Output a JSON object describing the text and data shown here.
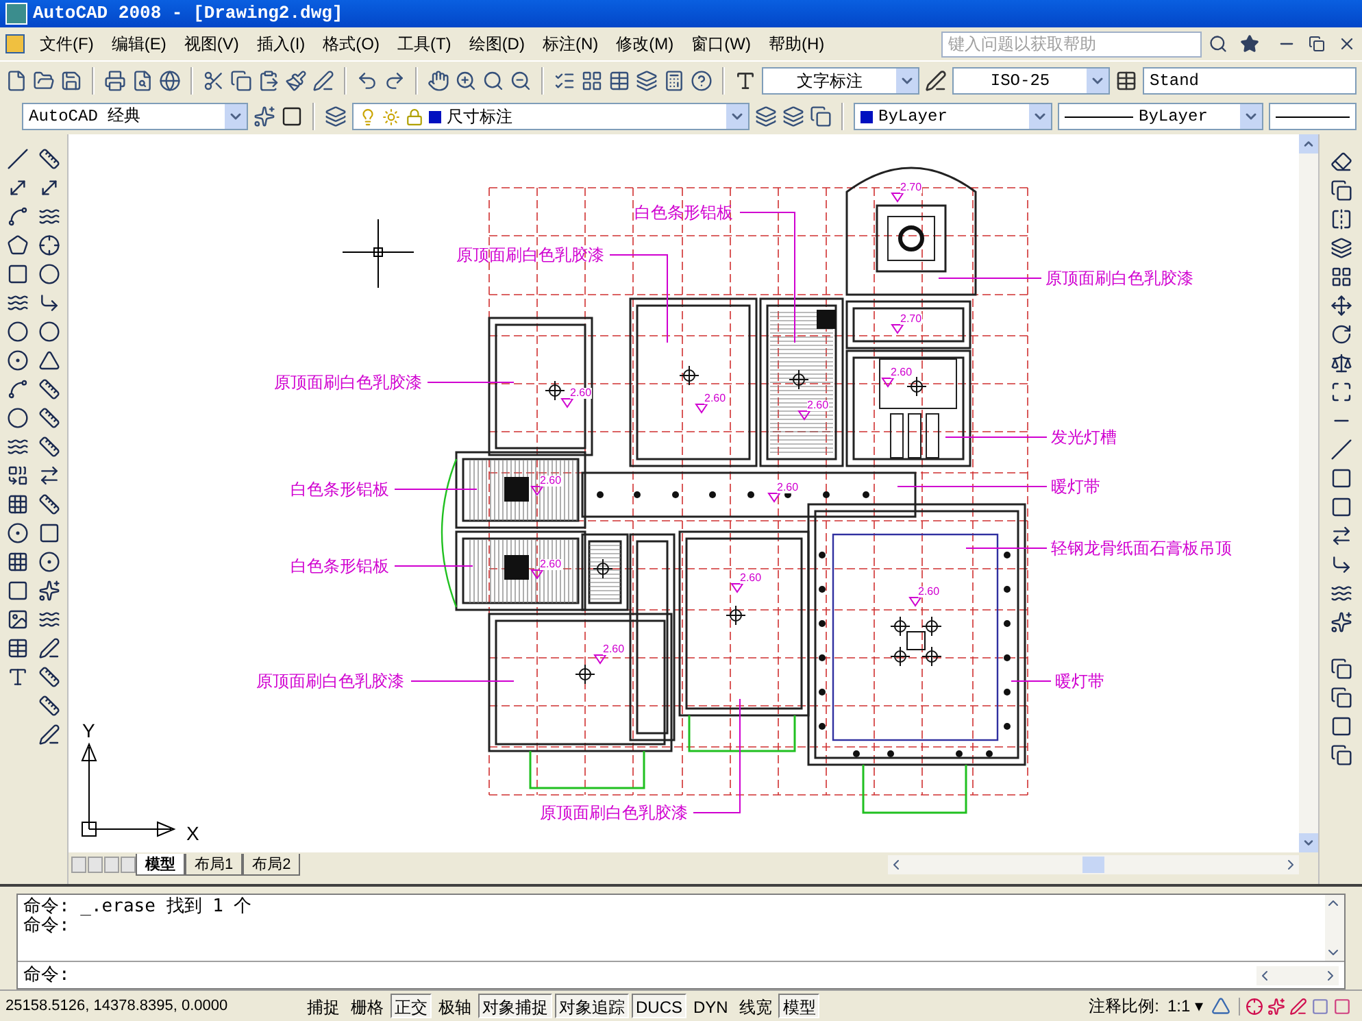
{
  "window": {
    "title": "AutoCAD 2008 - [Drawing2.dwg]"
  },
  "menu": [
    "文件(F)",
    "编辑(E)",
    "视图(V)",
    "插入(I)",
    "格式(O)",
    "工具(T)",
    "绘图(D)",
    "标注(N)",
    "修改(M)",
    "窗口(W)",
    "帮助(H)"
  ],
  "help_search": {
    "placeholder": "键入问题以获取帮助"
  },
  "styles_toolbar": {
    "text_style": "文字标注",
    "dim_style": "ISO-25",
    "table_style": "Stand"
  },
  "layers_toolbar": {
    "workspace": "AutoCAD 经典",
    "layer": "尺寸标注",
    "color_setting": "ByLayer",
    "linetype": "ByLayer"
  },
  "drawing": {
    "annotations": [
      {
        "text": "白色条形铝板"
      },
      {
        "text": "原顶面刷白色乳胶漆"
      },
      {
        "text": "原顶面刷白色乳胶漆"
      },
      {
        "text": "原顶面刷白色乳胶漆"
      },
      {
        "text": "发光灯槽"
      },
      {
        "text": "白色条形铝板"
      },
      {
        "text": "暖灯带"
      },
      {
        "text": "白色条形铝板"
      },
      {
        "text": "轻钢龙骨纸面石膏板吊顶"
      },
      {
        "text": "原顶面刷白色乳胶漆"
      },
      {
        "text": "暖灯带"
      },
      {
        "text": "原顶面刷白色乳胶漆"
      }
    ],
    "elevations": [
      "2.70",
      "2.70",
      "2.60",
      "2.60",
      "2.60",
      "2.60",
      "2.60",
      "2.60",
      "2.60",
      "2.60",
      "2.60",
      "2.60"
    ]
  },
  "ucs": {
    "y": "Y",
    "x": "X"
  },
  "layout_tabs": [
    {
      "label": "模型",
      "selected": true
    },
    {
      "label": "布局1",
      "selected": false
    },
    {
      "label": "布局2",
      "selected": false
    }
  ],
  "command_history": [
    "命令: _.erase 找到 1 个",
    "命令:"
  ],
  "command_prompt": "命令:",
  "status_bar": {
    "coordinates": "25158.5126, 14378.8395, 0.0000",
    "toggles": [
      {
        "label": "捕捉",
        "on": false
      },
      {
        "label": "栅格",
        "on": false
      },
      {
        "label": "正交",
        "on": true
      },
      {
        "label": "极轴",
        "on": false
      },
      {
        "label": "对象捕捉",
        "on": true
      },
      {
        "label": "对象追踪",
        "on": true
      },
      {
        "label": "DUCS",
        "on": true
      },
      {
        "label": "DYN",
        "on": false
      },
      {
        "label": "线宽",
        "on": false
      },
      {
        "label": "模型",
        "on": true
      }
    ],
    "annotation_scale_label": "注释比例:",
    "annotation_scale": "1:1 ▾"
  }
}
